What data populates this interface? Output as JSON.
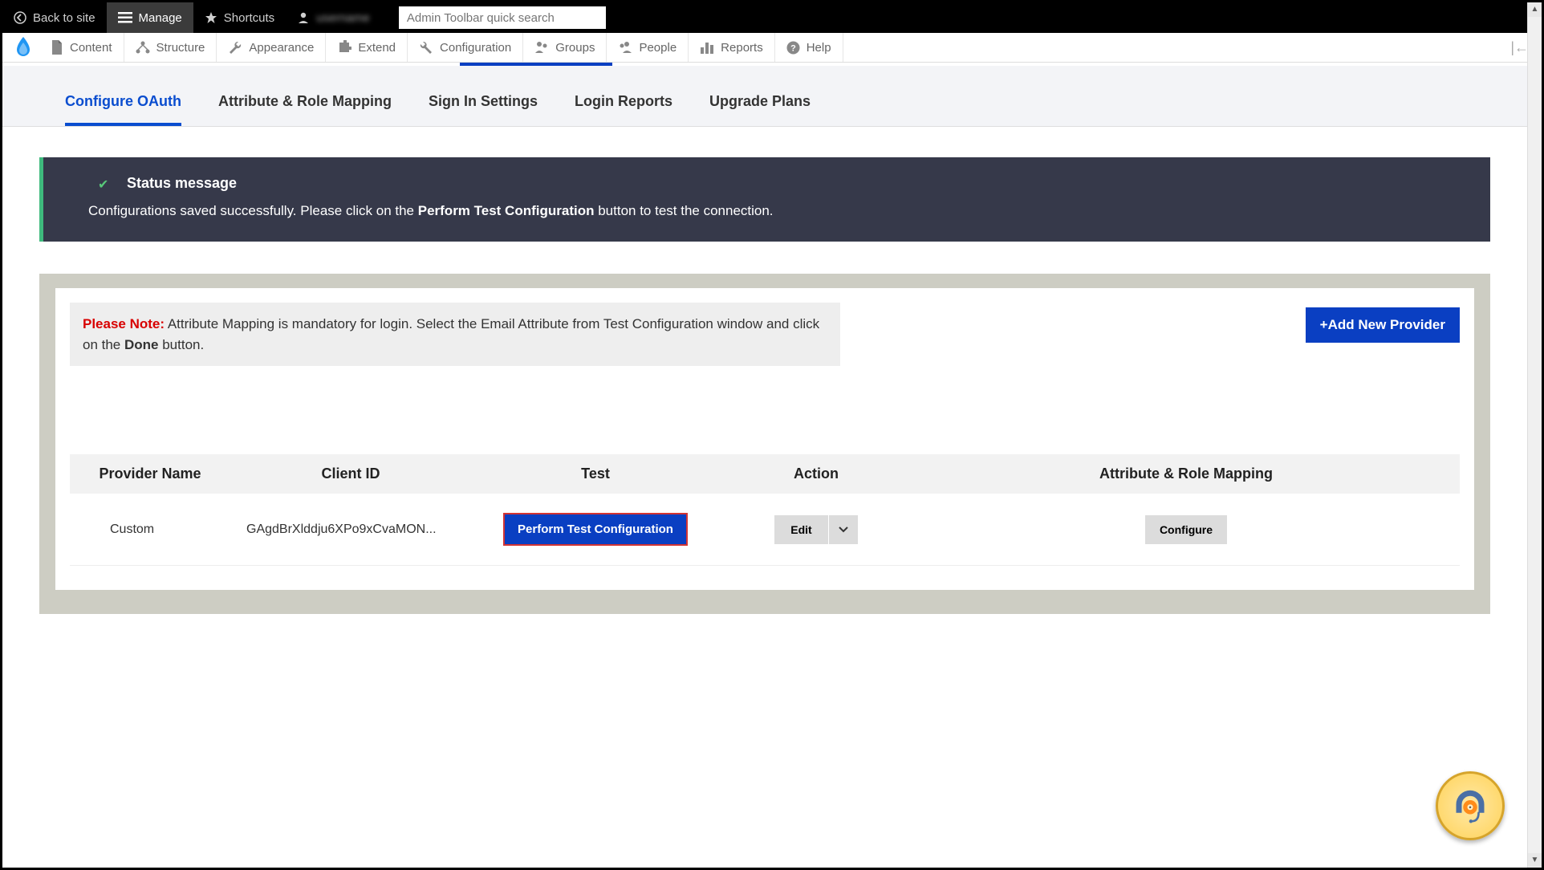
{
  "topbar": {
    "back": "Back to site",
    "manage": "Manage",
    "shortcuts": "Shortcuts",
    "search_placeholder": "Admin Toolbar quick search"
  },
  "adminmenu": {
    "content": "Content",
    "structure": "Structure",
    "appearance": "Appearance",
    "extend": "Extend",
    "configuration": "Configuration",
    "groups": "Groups",
    "people": "People",
    "reports": "Reports",
    "help": "Help"
  },
  "tabs": {
    "configure": "Configure OAuth",
    "attribute": "Attribute & Role Mapping",
    "signin": "Sign In Settings",
    "login_reports": "Login Reports",
    "upgrade": "Upgrade Plans"
  },
  "status": {
    "title": "Status message",
    "body_pre": "Configurations saved successfully. Please click on the ",
    "body_strong": "Perform Test Configuration",
    "body_post": " button to test the connection."
  },
  "note": {
    "prefix": "Please Note:",
    "text_pre": " Attribute Mapping is mandatory for login. Select the Email Attribute from Test Configuration window and click on the ",
    "text_strong": "Done",
    "text_post": " button."
  },
  "buttons": {
    "add_provider": "+Add New Provider",
    "test": "Perform Test Configuration",
    "edit": "Edit",
    "configure": "Configure"
  },
  "table": {
    "headers": {
      "provider": "Provider Name",
      "client_id": "Client ID",
      "test": "Test",
      "action": "Action",
      "mapping": "Attribute & Role Mapping"
    },
    "row": {
      "provider": "Custom",
      "client_id": "GAgdBrXlddju6XPo9xCvaMON..."
    }
  }
}
